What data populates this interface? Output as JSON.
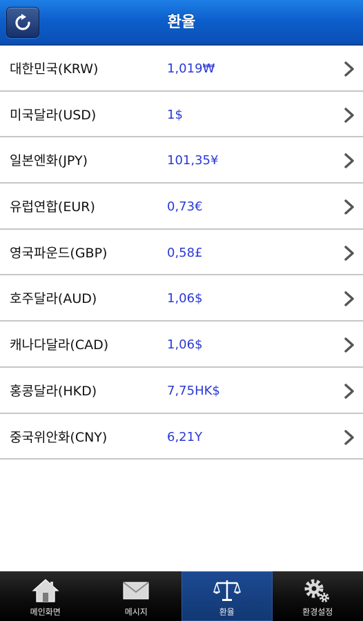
{
  "header": {
    "title": "환율",
    "refresh_icon": "refresh-icon"
  },
  "rates": [
    {
      "name": "대한민국(KRW)",
      "value": "1,019₩"
    },
    {
      "name": "미국달라(USD)",
      "value": "1$"
    },
    {
      "name": "일본엔화(JPY)",
      "value": "101,35¥"
    },
    {
      "name": "유럽연합(EUR)",
      "value": "0,73€"
    },
    {
      "name": "영국파운드(GBP)",
      "value": "0,58£"
    },
    {
      "name": "호주달라(AUD)",
      "value": "1,06$"
    },
    {
      "name": "캐나다달라(CAD)",
      "value": "1,06$"
    },
    {
      "name": "홍콩달라(HKD)",
      "value": "7,75HK$"
    },
    {
      "name": "중국위안화(CNY)",
      "value": "6,21Y"
    }
  ],
  "tabbar": {
    "tabs": [
      {
        "label": "메인화면",
        "icon": "home-icon",
        "active": false
      },
      {
        "label": "메시지",
        "icon": "envelope-icon",
        "active": false
      },
      {
        "label": "환율",
        "icon": "scale-icon",
        "active": true
      },
      {
        "label": "환경설정",
        "icon": "gear-icon",
        "active": false
      }
    ]
  },
  "colors": {
    "header_blue": "#0d5fcc",
    "value_blue": "#2a39d6",
    "divider": "#c6c6c6",
    "tab_active": "#1c4a93"
  }
}
